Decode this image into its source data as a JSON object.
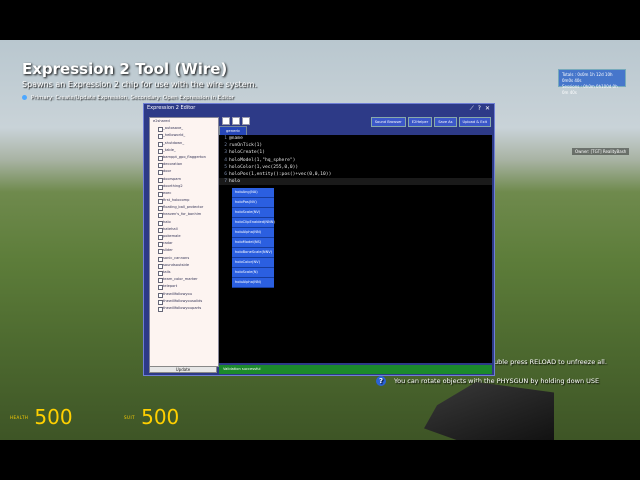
{
  "tool": {
    "title": "Expression 2 Tool (Wire)",
    "description": "Spawns an Expression 2 chip for use with the wire system.",
    "hint": "Primary: Create/Update Expression, Secondary: Open Expression in Editor"
  },
  "timer": {
    "line1": "Totals : 0s0m 1h 12d 10h 0m0s 40s",
    "line2": "Sessions : 0h0m 0h100d 0h 0m 40s"
  },
  "owner": "Owner: [TGT] RealityBash",
  "messages": {
    "reload": "uble press RELOAD to unfreeze all.",
    "physgun": "You can rotate objects with the PHYSGUN by holding down USE"
  },
  "hud": {
    "health_label": "HEALTH",
    "health_value": "500",
    "suit_label": "SUIT",
    "suit_value": "500"
  },
  "editor": {
    "title": "Expression 2 Editor",
    "tools": [
      "⟋",
      "?",
      "✕"
    ],
    "top_buttons": [
      "Sound Browser",
      "E2Helper",
      "Save As",
      "Upload & Exit"
    ],
    "tab": "generic",
    "tree": [
      "e2shared",
      "_autosave_",
      "_helloworld_",
      "_shutdown_",
      "_table_",
      "bamppt_gpo_flaggerton",
      "decoration",
      "door",
      "doorspam",
      "doorthing2",
      "exec",
      "first_holocomp",
      "floating_ball_protector",
      "heaven's_for_bonhim",
      "halo",
      "hatehall",
      "pokemale",
      "radar",
      "slider",
      "sonic_cannons",
      "soundsoutside",
      "tails",
      "team_color_marker",
      "teleport",
      "thewillfollowyou",
      "thewillfollowyousolids",
      "thewillfollowyouparts"
    ],
    "update_label": "Update",
    "code_lines": [
      "@name",
      "runOnTick(1)",
      "holoCreate(1)",
      "holoModel(1,\"hq_sphere\")",
      "holoColor(1,vec(255,0,0))",
      "holoPos(1,entity():pos()+vec(0,0,10))",
      "holo"
    ],
    "line_numbers": [
      "1",
      "2",
      "3",
      "4",
      "5",
      "6",
      "7"
    ],
    "autocomplete": [
      "holoAng(NA)",
      "holoPos(NV)",
      "holoScale(NV)",
      "holoClipEnabled(NNN)",
      "holoAlpha(NN)",
      "holoModel(NS)",
      "holoBoneScale(NNV)",
      "holoColor(NV)",
      "holoScale(N)",
      "holoAlpha(NN)"
    ],
    "status": "Validation successful"
  }
}
